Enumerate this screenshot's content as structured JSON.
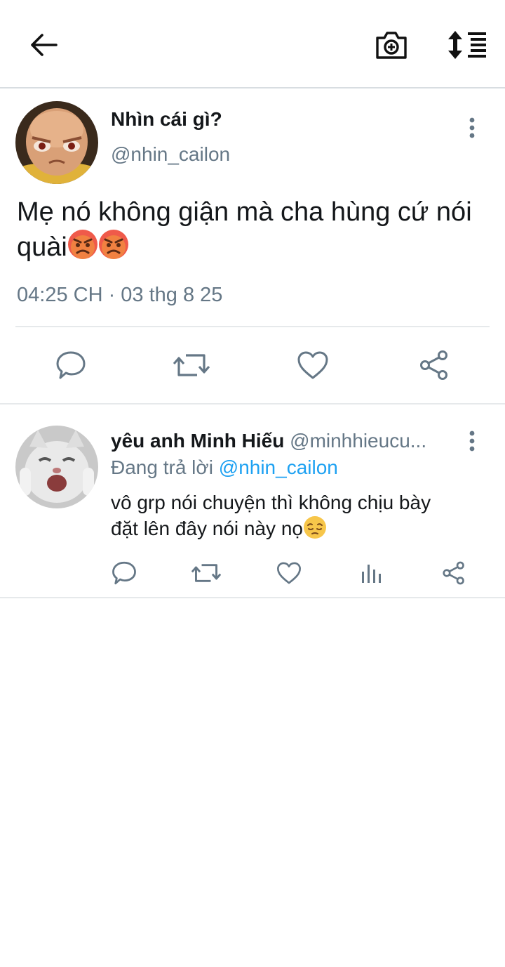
{
  "topbar": {
    "back_icon": "arrow-left-icon",
    "camera_icon": "camera-add-icon",
    "sort_icon": "sort-list-icon"
  },
  "tweet": {
    "display_name": "Nhìn cái gì?",
    "handle": "@nhin_cailon",
    "text": "Mẹ nó không giận mà cha hùng cứ nói quài",
    "emojis": [
      "angry-face",
      "angry-face"
    ],
    "timestamp": "04:25 CH · 03 thg 8 25",
    "actions": [
      "reply-icon",
      "retweet-icon",
      "like-icon",
      "share-icon"
    ]
  },
  "reply": {
    "display_name": "yêu anh Minh Hiếu",
    "handle": "@minhhieucu...",
    "replying_prefix": "Đang trả lời",
    "replying_to": "@nhin_cailon",
    "text_line1": "vô grp nói chuyện thì không chịu bày",
    "text_line2": "đặt lên đây nói này nọ",
    "emoji": "pensive-face",
    "actions": [
      "reply-icon",
      "retweet-icon",
      "like-icon",
      "analytics-icon",
      "share-icon"
    ]
  },
  "colors": {
    "text": "#14171a",
    "secondary": "#657786",
    "link": "#1da1f2",
    "divider": "#e6e9eb"
  }
}
